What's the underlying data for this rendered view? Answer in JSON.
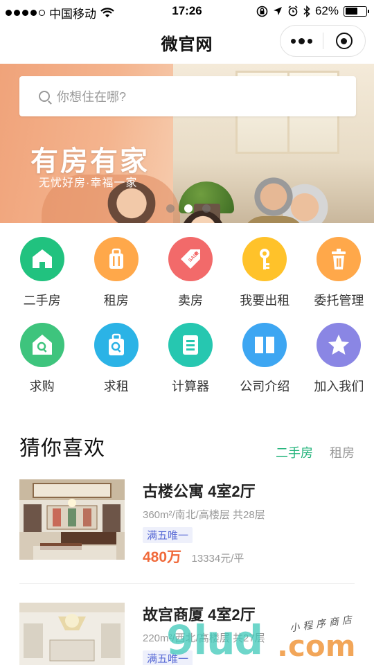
{
  "status_bar": {
    "carrier": "中国移动",
    "time": "17:26",
    "battery": "62%",
    "battery_level": 0.62,
    "signal_bars": 4,
    "signal_total": 5
  },
  "navbar": {
    "title": "微官网"
  },
  "search": {
    "placeholder": "你想住在哪?"
  },
  "banner": {
    "headline": "有房有家",
    "subline": "无忧好房·幸福一家",
    "slide_count": 3,
    "active_slide": 2
  },
  "categories": [
    {
      "label": "二手房",
      "icon": "home-icon",
      "color": "#21c27f"
    },
    {
      "label": "租房",
      "icon": "luggage-icon",
      "color": "#ffa84a"
    },
    {
      "label": "卖房",
      "icon": "sale-tag-icon",
      "color": "#f26a6a"
    },
    {
      "label": "我要出租",
      "icon": "key-icon",
      "color": "#ffc22a"
    },
    {
      "label": "委托管理",
      "icon": "trash-icon",
      "color": "#ffa84a"
    },
    {
      "label": "求购",
      "icon": "house-search-icon",
      "color": "#3ec47d"
    },
    {
      "label": "求租",
      "icon": "luggage-search-icon",
      "color": "#2bb3e6"
    },
    {
      "label": "计算器",
      "icon": "calculator-icon",
      "color": "#26c7b0"
    },
    {
      "label": "公司介绍",
      "icon": "book-icon",
      "color": "#3da6f2"
    },
    {
      "label": "加入我们",
      "icon": "star-icon",
      "color": "#8a86e4"
    }
  ],
  "recommend": {
    "title": "猜你喜欢",
    "tabs": [
      "二手房",
      "租房"
    ],
    "active_tab": 0
  },
  "listings": [
    {
      "name": "古楼公寓 4室2厅",
      "spec": "360m²/南北/高楼层 共28层",
      "tag": "满五唯一",
      "price": "480万",
      "unit_price": "13334元/平"
    },
    {
      "name": "故宫商厦 4室2厅",
      "spec": "220m²/西北/高楼层 共27层",
      "tag": "满五唯一",
      "price": "",
      "unit_price": ""
    }
  ],
  "watermark": {
    "text_a": "9lud",
    "text_b": ".com",
    "text_c": "小程序商店"
  },
  "colors": {
    "accent_green": "#21b37a",
    "price_orange": "#f06a3b",
    "tag_blue": "#5a6bd6"
  }
}
